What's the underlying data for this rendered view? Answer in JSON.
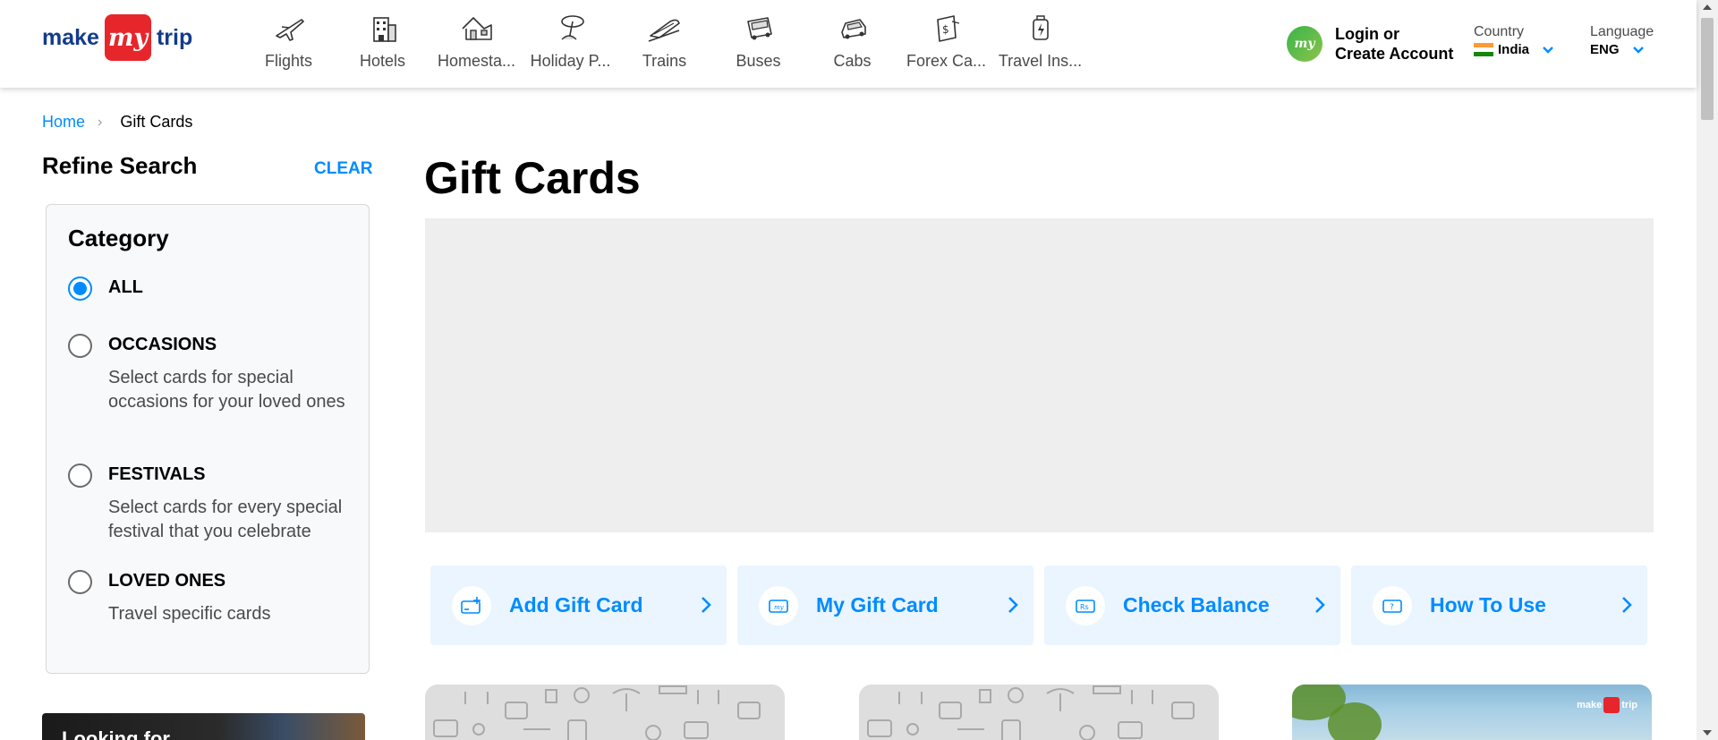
{
  "logo": {
    "left": "make",
    "mid": "my",
    "right": "trip"
  },
  "nav": [
    {
      "label": "Flights",
      "icon": "flight-icon"
    },
    {
      "label": "Hotels",
      "icon": "hotel-icon"
    },
    {
      "label": "Homesta...",
      "icon": "homestay-icon"
    },
    {
      "label": "Holiday P...",
      "icon": "holiday-icon"
    },
    {
      "label": "Trains",
      "icon": "train-icon"
    },
    {
      "label": "Buses",
      "icon": "bus-icon"
    },
    {
      "label": "Cabs",
      "icon": "cab-icon"
    },
    {
      "label": "Forex Ca...",
      "icon": "forex-icon"
    },
    {
      "label": "Travel Ins...",
      "icon": "insurance-icon"
    }
  ],
  "login": {
    "line1": "Login or",
    "line2": "Create Account",
    "avatar": "my"
  },
  "country": {
    "caption": "Country",
    "value": "India"
  },
  "language": {
    "caption": "Language",
    "value": "ENG"
  },
  "breadcrumb": {
    "home": "Home",
    "current": "Gift Cards"
  },
  "sidebar": {
    "title": "Refine Search",
    "clear": "CLEAR",
    "category_title": "Category",
    "options": [
      {
        "label": "ALL",
        "desc": "",
        "selected": true
      },
      {
        "label": "OCCASIONS",
        "desc": "Select cards for special occasions for your loved ones",
        "selected": false
      },
      {
        "label": "FESTIVALS",
        "desc": "Select cards for every special festival that you celebrate",
        "selected": false
      },
      {
        "label": "LOVED ONES",
        "desc": "Travel specific cards",
        "selected": false
      }
    ],
    "promo": "Looking for"
  },
  "main": {
    "title": "Gift Cards",
    "actions": [
      {
        "label": "Add Gift Card",
        "icon": "add-card-icon"
      },
      {
        "label": "My Gift Card",
        "icon": "my-card-icon"
      },
      {
        "label": "Check Balance",
        "icon": "balance-icon"
      },
      {
        "label": "How To Use",
        "icon": "help-icon"
      }
    ],
    "card_brand": {
      "left": "make",
      "mid": "my",
      "right": "trip"
    }
  },
  "colors": {
    "accent": "#008cff",
    "brand_red": "#e7262b",
    "brand_blue": "#133b8c",
    "action_bg": "#eaf5ff"
  }
}
